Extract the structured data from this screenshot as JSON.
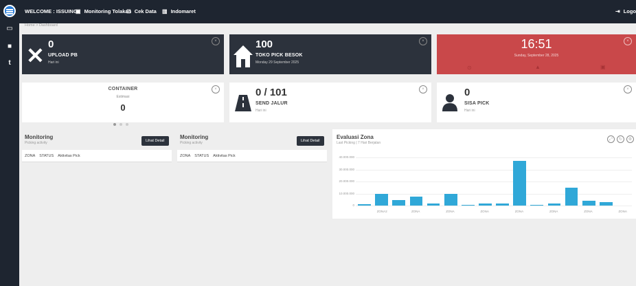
{
  "topbar": {
    "welcome": "WELCOME : ISSUING",
    "nav": [
      {
        "label": "Monitoring Tolakan",
        "icon": "monitor-icon"
      },
      {
        "label": "Cek Data",
        "icon": "box-icon"
      },
      {
        "label": "Indomaret",
        "icon": "building-icon"
      }
    ],
    "logout": "Logout"
  },
  "breadcrumb": "Home  >  Dashboard",
  "cards": {
    "upload_pb": {
      "value": "0",
      "label": "UPLOAD PB",
      "sub": "Hari ini"
    },
    "toko_pick": {
      "value": "100",
      "label": "TOKO PICK BESOK",
      "sub": "Monday 29 September 2025"
    },
    "clock": {
      "time": "16:51",
      "date": "Sunday, September 28, 2025"
    },
    "container": {
      "label": "CONTAINER",
      "sub": "Estimasi",
      "value": "0"
    },
    "send_jalur": {
      "value": "0 / 101",
      "label": "SEND JALUR",
      "sub": "Hari ini"
    },
    "sisa_pick": {
      "value": "0",
      "label": "SISA PICK",
      "sub": "Hari ini"
    }
  },
  "monitoring": [
    {
      "title": "Monitoring",
      "subtitle": "Picking activity",
      "button": "Lihat Detail",
      "columns": [
        "ZONA",
        "STATUS",
        "Aktivitas Pick"
      ]
    },
    {
      "title": "Monitoring",
      "subtitle": "Picking activity",
      "button": "Lihat Detail",
      "columns": [
        "ZONA",
        "STATUS",
        "Aktivitas Pick"
      ]
    }
  ],
  "evaluasi": {
    "title": "Evaluasi Zona",
    "subtitle": "Last Picking | 7 Hari Berjalan"
  },
  "chart_data": {
    "type": "bar",
    "categories": [
      "",
      "ZONA2",
      "",
      "ZONA",
      "",
      "ZONA",
      "",
      "ZONA",
      "",
      "ZONA",
      "",
      "ZONA",
      "",
      "ZONA",
      "",
      "ZONA"
    ],
    "values": [
      1000000,
      10000000,
      4500000,
      7500000,
      1500000,
      10000000,
      800000,
      1500000,
      2000000,
      37000000,
      500000,
      1500000,
      15000000,
      4000000,
      3000000,
      0
    ],
    "ytick_labels": [
      "0",
      "10.000.000",
      "20.000.000",
      "30.000.000",
      "40.000.000"
    ],
    "ylim": [
      0,
      40000000
    ],
    "grid": true
  }
}
